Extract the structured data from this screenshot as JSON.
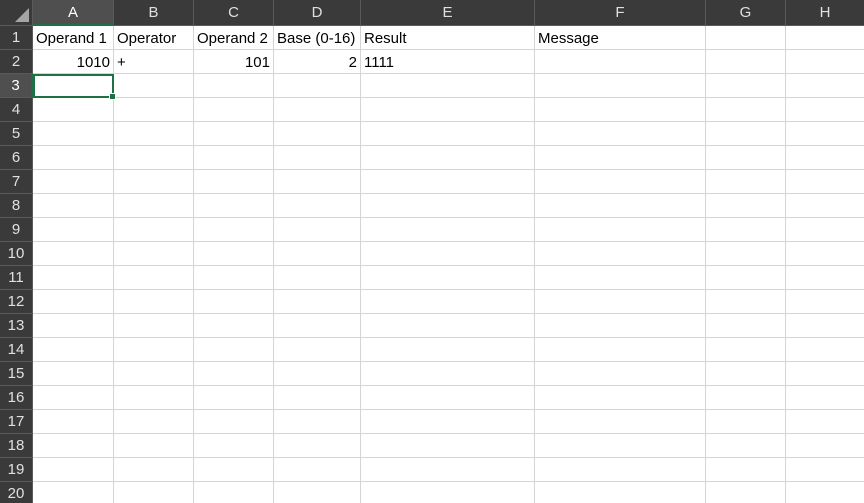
{
  "columns": [
    "A",
    "B",
    "C",
    "D",
    "E",
    "F",
    "G",
    "H"
  ],
  "rows": [
    "1",
    "2",
    "3",
    "4",
    "5",
    "6",
    "7",
    "8",
    "9",
    "10",
    "11",
    "12",
    "13",
    "14",
    "15",
    "16",
    "17",
    "18",
    "19",
    "20"
  ],
  "cells": {
    "A1": "Operand 1",
    "B1": "Operator",
    "C1": "Operand 2",
    "D1": "Base (0-16)",
    "E1": "Result",
    "F1": "Message",
    "A2": "1010",
    "B2": "+",
    "C2": "101",
    "D2": "2",
    "E2": "1111"
  },
  "numeric_cells": [
    "A2",
    "C2",
    "D2"
  ],
  "active_cell": "A3",
  "colors": {
    "header_bg": "#3a3a3a",
    "header_text": "#e0e0e0",
    "selection_accent": "#1e7145",
    "gridline": "#d4d4d4"
  }
}
